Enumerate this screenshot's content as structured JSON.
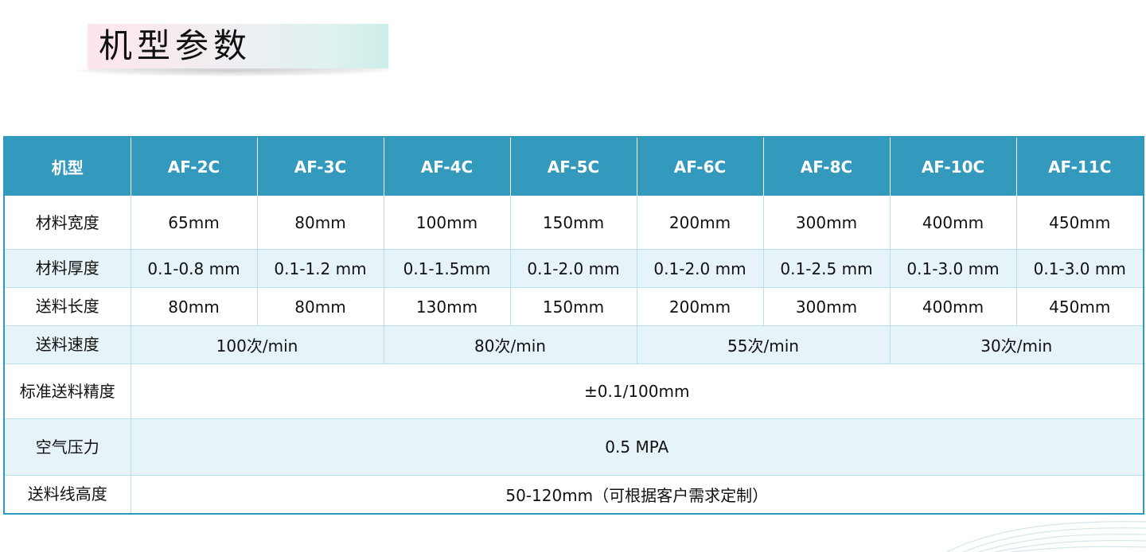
{
  "title": "机型参数",
  "colors": {
    "header_bg": "#3399bd",
    "header_text": "#ffffff",
    "row_tint": "#e6f3f8",
    "border": "#b8ddec"
  },
  "table": {
    "header": [
      "机型",
      "AF-2C",
      "AF-3C",
      "AF-4C",
      "AF-5C",
      "AF-6C",
      "AF-8C",
      "AF-10C",
      "AF-11C"
    ],
    "material_width": {
      "label": "材料宽度",
      "values": [
        "65mm",
        "80mm",
        "100mm",
        "150mm",
        "200mm",
        "300mm",
        "400mm",
        "450mm"
      ]
    },
    "material_thickness": {
      "label": "材料厚度",
      "values": [
        "0.1-0.8 mm",
        "0.1-1.2 mm",
        "0.1-1.5mm",
        "0.1-2.0 mm",
        "0.1-2.0 mm",
        "0.1-2.5 mm",
        "0.1-3.0 mm",
        "0.1-3.0 mm"
      ]
    },
    "feed_length": {
      "label": "送料长度",
      "values": [
        "80mm",
        "80mm",
        "130mm",
        "150mm",
        "200mm",
        "300mm",
        "400mm",
        "450mm"
      ]
    },
    "feed_speed": {
      "label": "送料速度",
      "values": [
        "100次/min",
        "80次/min",
        "55次/min",
        "30次/min"
      ]
    },
    "feed_accuracy": {
      "label": "标准送料精度",
      "value": "±0.1/100mm"
    },
    "air_pressure": {
      "label": "空气压力",
      "value": "0.5 MPA"
    },
    "feed_line_height": {
      "label": "送料线高度",
      "value": "50-120mm（可根据客户需求定制）"
    }
  }
}
